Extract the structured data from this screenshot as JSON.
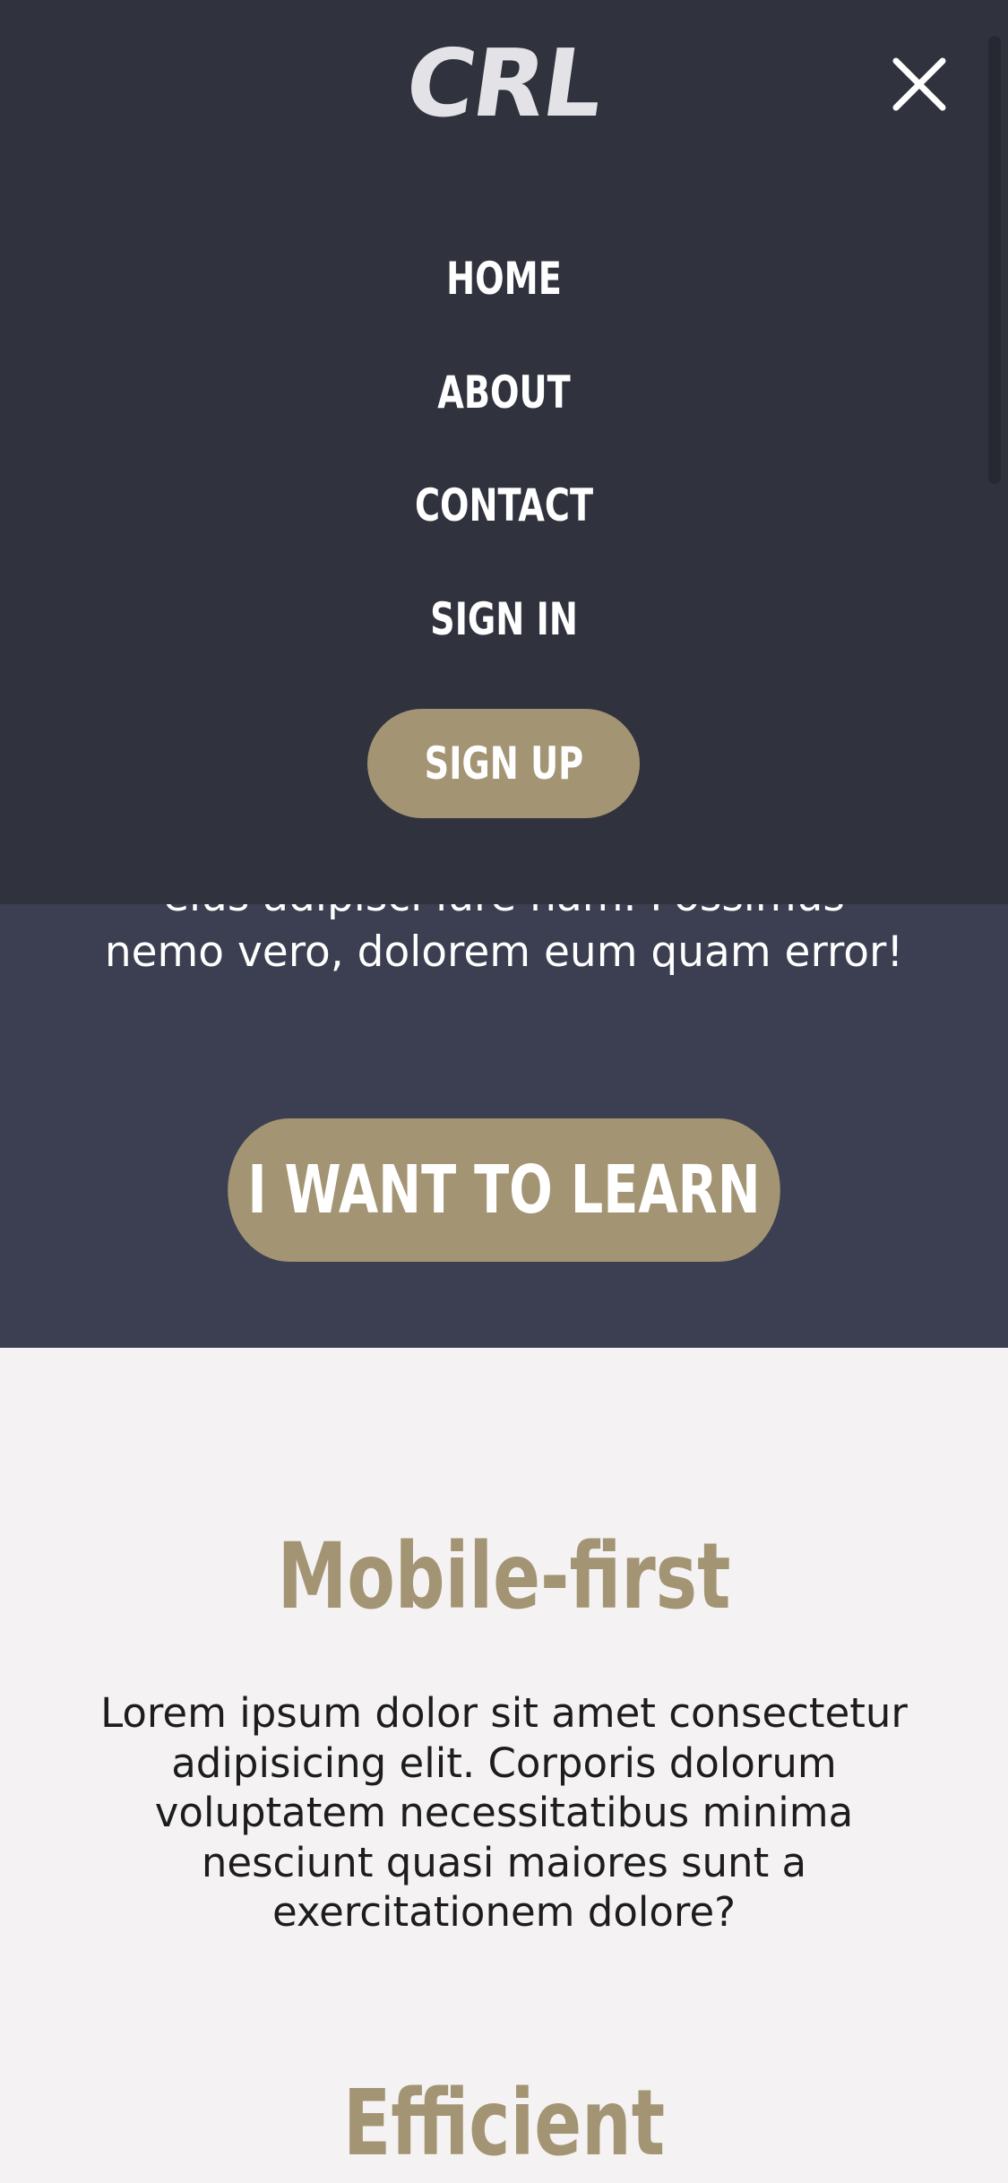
{
  "header": {
    "logo_text": "CRL",
    "close_icon": "close-icon"
  },
  "nav": {
    "items": [
      {
        "label": "HOME"
      },
      {
        "label": "ABOUT"
      },
      {
        "label": "CONTACT"
      },
      {
        "label": "SIGN IN"
      }
    ],
    "signup_label": "SIGN UP"
  },
  "hero": {
    "text_lines": [
      "eius adipisci iure nam. Possimus",
      "nemo vero, dolorem eum quam error!"
    ],
    "cta_label": "I WANT TO LEARN"
  },
  "features": [
    {
      "title": "Mobile-first",
      "text_lines": [
        "Lorem ipsum dolor sit amet consectetur",
        "adipisicing elit. Corporis dolorum",
        "voluptatem necessitatibus minima",
        "nesciunt quasi maiores sunt a",
        "exercitationem dolore?"
      ]
    },
    {
      "title": "Efficient"
    }
  ],
  "colors": {
    "overlay_bg": "#30323e",
    "hero_bg": "#3b3f51",
    "accent": "#a39474",
    "page_bg": "#f4f2f3",
    "text_dark": "#1d1d1d",
    "text_light": "#ffffff"
  }
}
